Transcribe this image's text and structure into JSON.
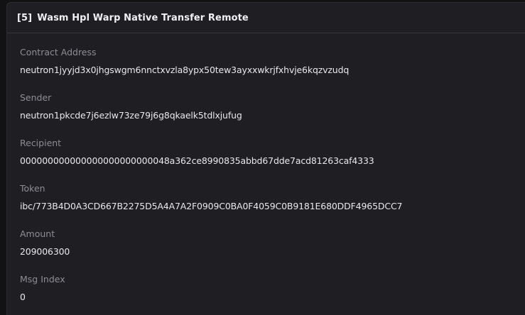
{
  "message": {
    "index_label": "[5]",
    "title": "Wasm Hpl Warp Native Transfer Remote",
    "fields": [
      {
        "label": "Contract Address",
        "value": "neutron1jyyjd3x0jhgswgm6nnctxvzla8ypx50tew3ayxxwkrjfxhvje6kqzvzudq"
      },
      {
        "label": "Sender",
        "value": "neutron1pkcde7j6ezlw73ze79j6g8qkaelk5tdlxjufug"
      },
      {
        "label": "Recipient",
        "value": "000000000000000000000000048a362ce8990835abbd67dde7acd81263caf4333"
      },
      {
        "label": "Token",
        "value": "ibc/773B4D0A3CD667B2275D5A4A7A2F0909C0BA0F4059C0B9181E680DDF4965DCC7"
      },
      {
        "label": "Amount",
        "value": "209006300"
      },
      {
        "label": "Msg Index",
        "value": "0"
      }
    ]
  }
}
